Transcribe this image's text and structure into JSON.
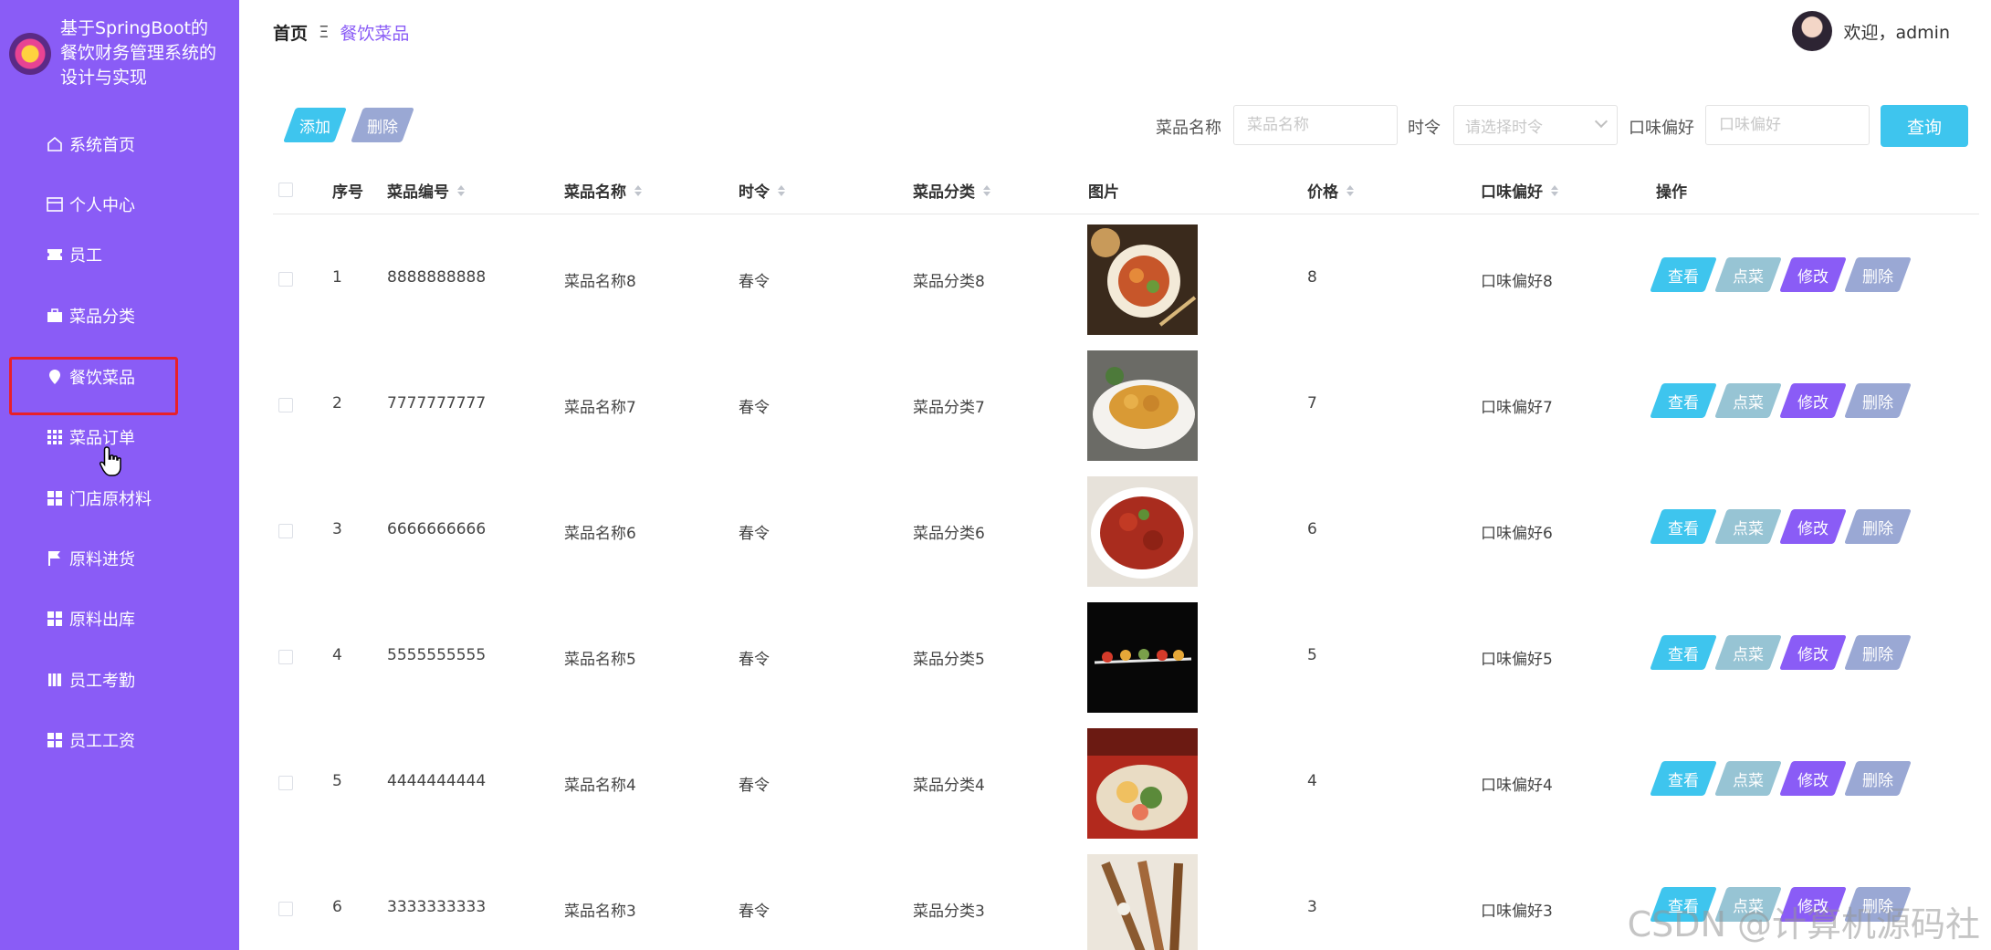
{
  "app": {
    "title": "基于SpringBoot的餐饮财务管理系统的设计与实现"
  },
  "sidebar": {
    "items": [
      {
        "label": "系统首页",
        "icon": "home-icon"
      },
      {
        "label": "个人中心",
        "icon": "id-card-icon"
      },
      {
        "label": "员工",
        "icon": "ticket-icon"
      },
      {
        "label": "菜品分类",
        "icon": "briefcase-icon"
      },
      {
        "label": "餐饮菜品",
        "icon": "pin-icon",
        "active": true
      },
      {
        "label": "菜品订单",
        "icon": "grid-icon"
      },
      {
        "label": "门店原材料",
        "icon": "apps-icon"
      },
      {
        "label": "原料进货",
        "icon": "flag-icon"
      },
      {
        "label": "原料出库",
        "icon": "apps-icon"
      },
      {
        "label": "员工考勤",
        "icon": "book-icon"
      },
      {
        "label": "员工工资",
        "icon": "apps-icon"
      }
    ]
  },
  "header": {
    "breadcrumb_home": "首页",
    "breadcrumb_sep": "Ξ",
    "breadcrumb_current": "餐饮菜品",
    "welcome": "欢迎，admin"
  },
  "toolbar": {
    "add_label": "添加",
    "delete_label": "删除",
    "search": {
      "name_label": "菜品名称",
      "name_placeholder": "菜品名称",
      "season_label": "时令",
      "season_placeholder": "请选择时令",
      "taste_label": "口味偏好",
      "taste_placeholder": "口味偏好",
      "query_label": "查询"
    }
  },
  "table": {
    "headers": {
      "index": "序号",
      "code": "菜品编号",
      "name": "菜品名称",
      "season": "时令",
      "category": "菜品分类",
      "image": "图片",
      "price": "价格",
      "taste": "口味偏好",
      "actions": "操作"
    },
    "action_labels": {
      "view": "查看",
      "order": "点菜",
      "edit": "修改",
      "delete": "删除"
    },
    "rows": [
      {
        "index": "1",
        "code": "8888888888",
        "name": "菜品名称8",
        "season": "春令",
        "category": "菜品分类8",
        "price": "8",
        "taste": "口味偏好8"
      },
      {
        "index": "2",
        "code": "7777777777",
        "name": "菜品名称7",
        "season": "春令",
        "category": "菜品分类7",
        "price": "7",
        "taste": "口味偏好7"
      },
      {
        "index": "3",
        "code": "6666666666",
        "name": "菜品名称6",
        "season": "春令",
        "category": "菜品分类6",
        "price": "6",
        "taste": "口味偏好6"
      },
      {
        "index": "4",
        "code": "5555555555",
        "name": "菜品名称5",
        "season": "春令",
        "category": "菜品分类5",
        "price": "5",
        "taste": "口味偏好5"
      },
      {
        "index": "5",
        "code": "4444444444",
        "name": "菜品名称4",
        "season": "春令",
        "category": "菜品分类4",
        "price": "4",
        "taste": "口味偏好4"
      },
      {
        "index": "6",
        "code": "3333333333",
        "name": "菜品名称3",
        "season": "春令",
        "category": "菜品分类3",
        "price": "3",
        "taste": "口味偏好3"
      }
    ]
  },
  "watermark": "CSDN @计算机源码社",
  "colors": {
    "sidebar": "#8a5cf6",
    "accent_cyan": "#3ec5ee",
    "accent_purple": "#8a5cf6",
    "muted_blue": "#9aa8d4",
    "active_outline": "#e8202a"
  }
}
